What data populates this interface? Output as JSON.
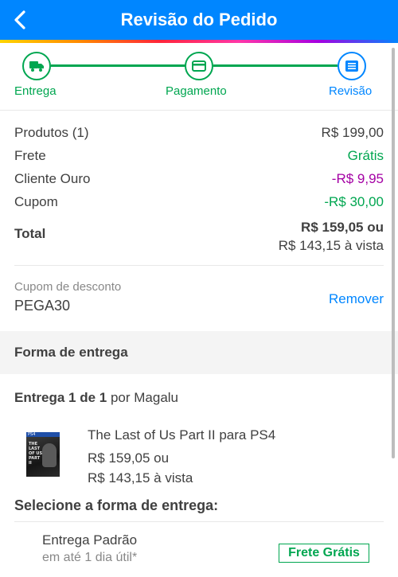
{
  "header": {
    "title": "Revisão do Pedido",
    "back_icon": "chevron-left-icon"
  },
  "steps": [
    {
      "label": "Entrega",
      "icon": "truck-icon",
      "state": "done"
    },
    {
      "label": "Pagamento",
      "icon": "card-icon",
      "state": "done"
    },
    {
      "label": "Revisão",
      "icon": "list-icon",
      "state": "current"
    }
  ],
  "summary": {
    "products_label": "Produtos (1)",
    "products_value": "R$ 199,00",
    "shipping_label": "Frete",
    "shipping_value": "Grátis",
    "gold_label": "Cliente Ouro",
    "gold_value": "-R$ 9,95",
    "coupon_label": "Cupom",
    "coupon_value": "-R$ 30,00",
    "total_label": "Total",
    "total_value": "R$ 159,05 ou",
    "total_cash": "R$ 143,15 à vista"
  },
  "coupon": {
    "label": "Cupom de desconto",
    "code": "PEGA30",
    "remove": "Remover"
  },
  "delivery": {
    "section_title": "Forma de entrega",
    "count": "Entrega 1 de 1",
    "by": "por Magalu",
    "product": {
      "name": "The Last of Us Part II para PS4",
      "price": "R$ 159,05 ou",
      "cash": "R$ 143,15 à vista",
      "cover_text": "THE LAST OF US PART II",
      "cover_brand": "PS4"
    },
    "select_title": "Selecione a forma de entrega:",
    "option": {
      "name": "Entrega Padrão",
      "eta": "em até 1 dia útil*",
      "badge": "Frete Grátis"
    }
  },
  "colors": {
    "brand": "#0086ff",
    "success": "#00a650",
    "discount": "#a400a4",
    "muted": "#888888"
  }
}
